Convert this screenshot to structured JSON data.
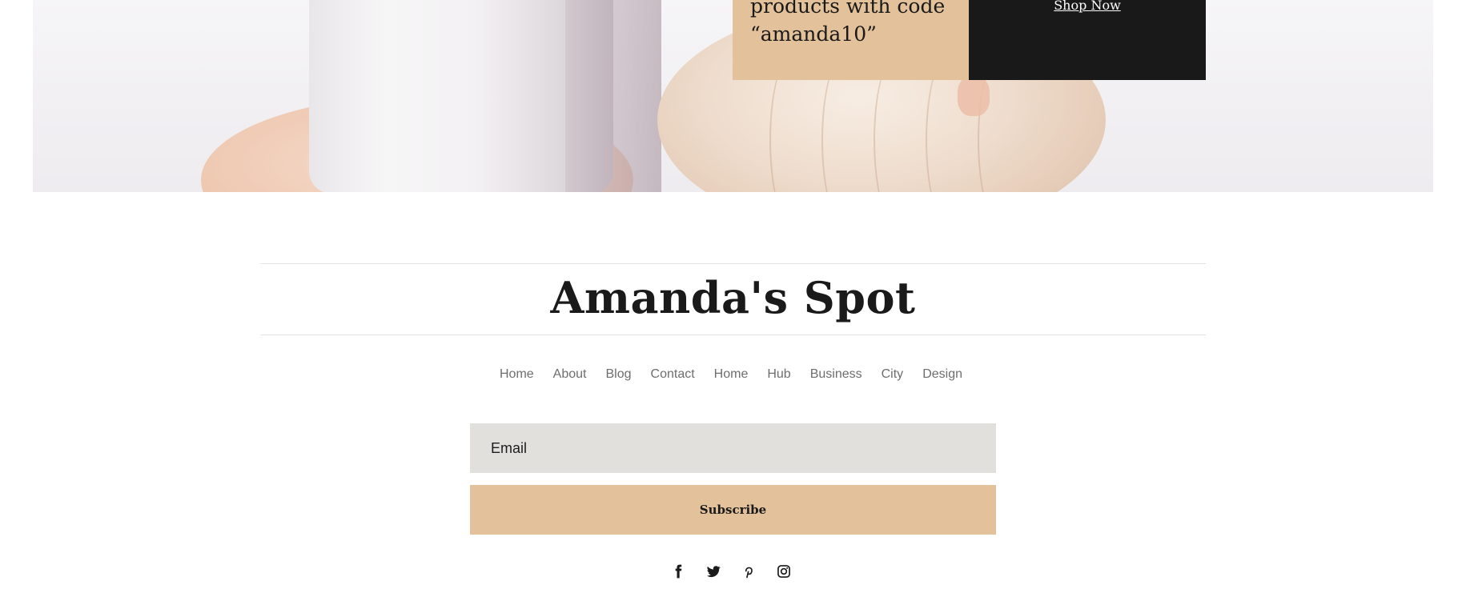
{
  "promo": {
    "text": "products with code\n“amanda10”",
    "cta": "Shop Now"
  },
  "footer": {
    "brand": "Amanda's Spot",
    "nav": [
      "Home",
      "About",
      "Blog",
      "Contact",
      "Home",
      "Hub",
      "Business",
      "City",
      "Design"
    ],
    "email_placeholder": "Email",
    "subscribe_label": "Subscribe",
    "social_icons": [
      "facebook-icon",
      "twitter-icon",
      "pinterest-icon",
      "instagram-icon"
    ]
  },
  "colors": {
    "accent": "#e2c19b",
    "dark": "#1a1919",
    "input_bg": "#e1e0dd",
    "text": "#1b1a1a",
    "nav_text": "#6e6e6e"
  }
}
